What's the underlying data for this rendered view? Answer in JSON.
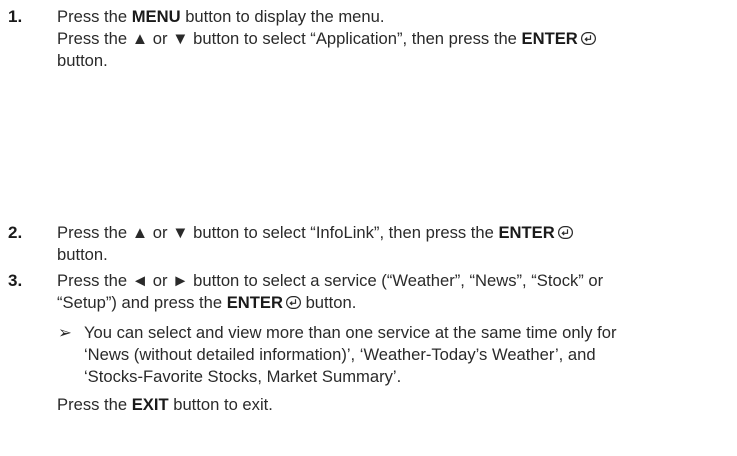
{
  "steps": [
    {
      "number": "1.",
      "line1": {
        "pre": "Press the ",
        "bold": "MENU",
        "post": " button to display the menu."
      },
      "line2": {
        "pre": "Press the ▲ or ▼ button to select “Application”, then press the ",
        "bold": "ENTER"
      },
      "line3": "button."
    },
    {
      "number": "2.",
      "line1": {
        "pre": "Press the ▲ or ▼ button to select “InfoLink”, then press the ",
        "bold": "ENTER"
      },
      "line2": "button."
    },
    {
      "number": "3.",
      "line1": "Press the ◄ or ► button to select a service (“Weather”, “News”, “Stock” or",
      "line2": {
        "pre": "“Setup”) and press the ",
        "bold": "ENTER",
        "post": " button."
      }
    }
  ],
  "note": {
    "arrow": "➢",
    "lines": [
      "You can select and view more than one service at the same time only for",
      "‘News (without detailed information)’, ‘Weather-Today’s Weather’, and",
      "‘Stocks-Favorite Stocks, Market Summary’."
    ]
  },
  "exit": {
    "pre": "Press the ",
    "bold": "EXIT",
    "post": " button to exit."
  },
  "icons": {
    "enter": "enter-icon",
    "note_arrow": "note-arrow-icon"
  }
}
